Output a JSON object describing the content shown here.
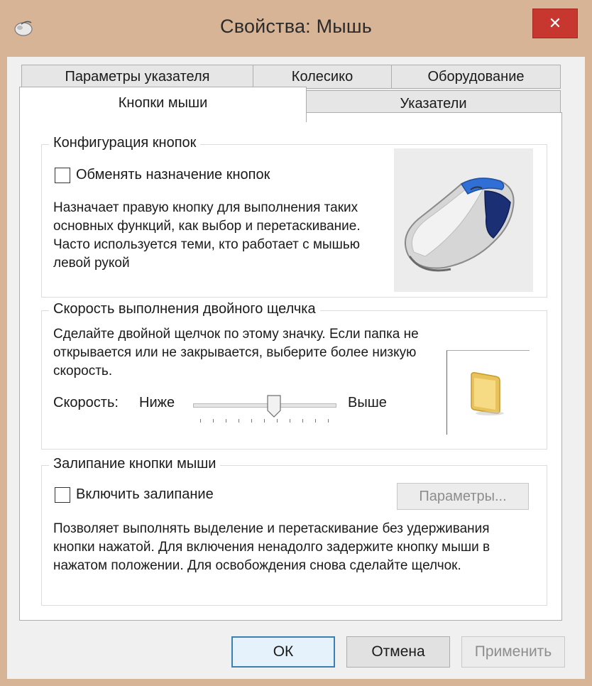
{
  "window": {
    "title": "Свойства: Мышь",
    "close_glyph": "✕"
  },
  "tabs_top": [
    "Параметры указателя",
    "Колесико",
    "Оборудование"
  ],
  "tabs_bottom": [
    "Кнопки мыши",
    "Указатели"
  ],
  "button_config": {
    "title": "Конфигурация кнопок",
    "swap_label": "Обменять назначение кнопок",
    "swap_checked": false,
    "description": "Назначает правую кнопку для выполнения таких основных функций, как выбор и перетаскивание. Часто используется теми, кто работает с мышью левой рукой",
    "image_icon": "mouse-icon"
  },
  "double_click": {
    "title": "Скорость выполнения двойного щелчка",
    "description": "Сделайте двойной щелчок по этому значку. Если папка не открывается или не закрывается, выберите более низкую скорость.",
    "speed_label": "Скорость:",
    "low_label": "Ниже",
    "high_label": "Выше",
    "speed_level": 0.58,
    "test_icon": "folder-icon"
  },
  "click_lock": {
    "title": "Залипание кнопки мыши",
    "enable_label": "Включить залипание",
    "enable_checked": false,
    "settings_button": "Параметры...",
    "description": "Позволяет выполнять выделение и перетаскивание без удерживания кнопки нажатой. Для включения ненадолго задержите кнопку мыши в нажатом положении. Для освобождения снова сделайте щелчок."
  },
  "footer": {
    "ok": "ОК",
    "cancel": "Отмена",
    "apply": "Применить"
  },
  "colors": {
    "frame": "#d8b497",
    "close": "#c7372f",
    "accent": "#3c7fb1"
  }
}
